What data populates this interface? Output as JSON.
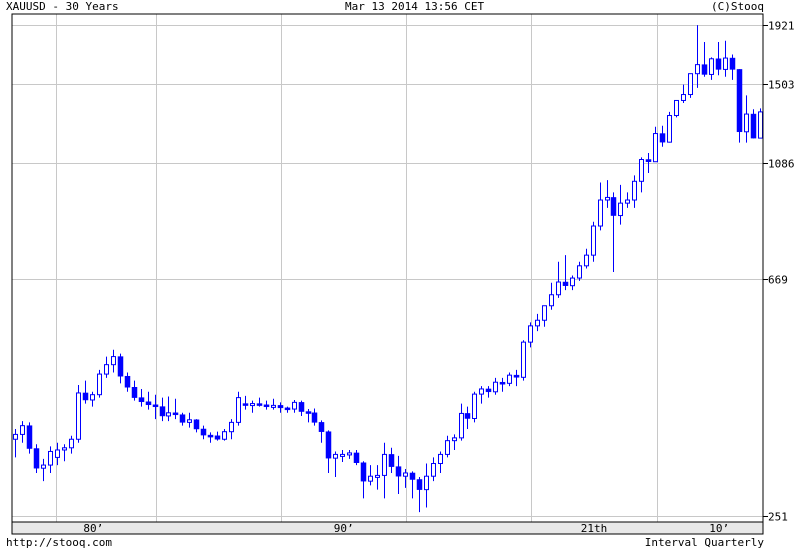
{
  "header": {
    "left": "XAUUSD - 30 Years",
    "center": "Mar 13 2014 13:56 CET",
    "right": "(C)Stooq"
  },
  "footer": {
    "left": "http://stooq.com",
    "right": "Interval Quarterly"
  },
  "colors": {
    "candle": "#0000ff",
    "grid": "#c8c8c8",
    "frame": "#000000",
    "xaxis_band": "#e8e8e8"
  },
  "chart_data": {
    "type": "candlestick",
    "title": "XAUUSD - 30 Years",
    "interval": "Quarterly",
    "y_scale": "log",
    "ylim": [
      251,
      1921
    ],
    "y_ticks": [
      251,
      669,
      1086,
      1503,
      1921
    ],
    "x_start": 1984.25,
    "x_end": 2014.25,
    "x_ticks": [
      {
        "label": "80’",
        "year": 1987.5
      },
      {
        "label": "90’",
        "year": 1997.5
      },
      {
        "label": "21th",
        "year": 2007.5
      },
      {
        "label": "10’",
        "year": 2012.5
      }
    ],
    "x_gridlines": [
      1986.0,
      1990.0,
      1995.0,
      2000.0,
      2005.0,
      2010.0
    ],
    "ohlc": [
      [
        345,
        360,
        320,
        352
      ],
      [
        352,
        372,
        340,
        365
      ],
      [
        365,
        370,
        325,
        332
      ],
      [
        332,
        338,
        300,
        306
      ],
      [
        306,
        318,
        290,
        310
      ],
      [
        310,
        335,
        300,
        328
      ],
      [
        320,
        340,
        310,
        330
      ],
      [
        330,
        338,
        315,
        333
      ],
      [
        333,
        350,
        325,
        345
      ],
      [
        345,
        432,
        340,
        418
      ],
      [
        418,
        440,
        400,
        406
      ],
      [
        406,
        420,
        395,
        415
      ],
      [
        415,
        460,
        410,
        452
      ],
      [
        452,
        486,
        445,
        470
      ],
      [
        470,
        500,
        455,
        486
      ],
      [
        486,
        492,
        435,
        448
      ],
      [
        448,
        455,
        420,
        428
      ],
      [
        428,
        440,
        405,
        410
      ],
      [
        410,
        425,
        395,
        403
      ],
      [
        403,
        420,
        390,
        398
      ],
      [
        398,
        415,
        375,
        395
      ],
      [
        395,
        410,
        372,
        380
      ],
      [
        380,
        412,
        372,
        385
      ],
      [
        385,
        408,
        375,
        382
      ],
      [
        382,
        385,
        365,
        370
      ],
      [
        370,
        385,
        362,
        374
      ],
      [
        374,
        375,
        355,
        360
      ],
      [
        360,
        365,
        345,
        351
      ],
      [
        351,
        355,
        340,
        350
      ],
      [
        350,
        356,
        343,
        345
      ],
      [
        345,
        360,
        343,
        356
      ],
      [
        356,
        375,
        345,
        370
      ],
      [
        370,
        420,
        365,
        410
      ],
      [
        400,
        413,
        390,
        398
      ],
      [
        398,
        405,
        385,
        400
      ],
      [
        400,
        410,
        395,
        398
      ],
      [
        398,
        405,
        390,
        395
      ],
      [
        395,
        408,
        390,
        397
      ],
      [
        397,
        402,
        385,
        393
      ],
      [
        393,
        395,
        385,
        391
      ],
      [
        391,
        406,
        385,
        402
      ],
      [
        402,
        405,
        380,
        387
      ],
      [
        387,
        391,
        370,
        385
      ],
      [
        385,
        392,
        365,
        370
      ],
      [
        370,
        373,
        340,
        356
      ],
      [
        356,
        358,
        300,
        319
      ],
      [
        319,
        328,
        295,
        324
      ],
      [
        324,
        330,
        314,
        324
      ],
      [
        324,
        330,
        318,
        326
      ],
      [
        326,
        330,
        310,
        313
      ],
      [
        313,
        315,
        270,
        290
      ],
      [
        290,
        310,
        285,
        296
      ],
      [
        296,
        310,
        280,
        297
      ],
      [
        297,
        340,
        270,
        324
      ],
      [
        324,
        333,
        300,
        308
      ],
      [
        308,
        322,
        275,
        296
      ],
      [
        296,
        305,
        282,
        300
      ],
      [
        300,
        302,
        270,
        292
      ],
      [
        292,
        295,
        255,
        280
      ],
      [
        280,
        312,
        260,
        296
      ],
      [
        296,
        320,
        290,
        312
      ],
      [
        312,
        328,
        300,
        324
      ],
      [
        324,
        350,
        320,
        343
      ],
      [
        343,
        352,
        330,
        347
      ],
      [
        347,
        400,
        343,
        384
      ],
      [
        384,
        395,
        360,
        376
      ],
      [
        376,
        420,
        370,
        416
      ],
      [
        416,
        430,
        400,
        425
      ],
      [
        425,
        430,
        410,
        420
      ],
      [
        420,
        445,
        415,
        437
      ],
      [
        437,
        445,
        420,
        435
      ],
      [
        435,
        455,
        430,
        450
      ],
      [
        450,
        460,
        430,
        446
      ],
      [
        446,
        520,
        440,
        516
      ],
      [
        516,
        560,
        505,
        552
      ],
      [
        552,
        580,
        540,
        565
      ],
      [
        565,
        600,
        550,
        600
      ],
      [
        600,
        660,
        590,
        628
      ],
      [
        628,
        720,
        620,
        662
      ],
      [
        662,
        740,
        640,
        652
      ],
      [
        652,
        680,
        640,
        673
      ],
      [
        673,
        720,
        665,
        708
      ],
      [
        708,
        760,
        700,
        740
      ],
      [
        740,
        850,
        720,
        835
      ],
      [
        835,
        1000,
        820,
        930
      ],
      [
        930,
        1010,
        900,
        940
      ],
      [
        940,
        960,
        690,
        872
      ],
      [
        872,
        990,
        840,
        918
      ],
      [
        918,
        960,
        900,
        930
      ],
      [
        930,
        1030,
        900,
        1005
      ],
      [
        1005,
        1110,
        960,
        1100
      ],
      [
        1100,
        1130,
        1040,
        1090
      ],
      [
        1090,
        1260,
        1090,
        1225
      ],
      [
        1225,
        1265,
        1160,
        1182
      ],
      [
        1182,
        1340,
        1180,
        1320
      ],
      [
        1320,
        1400,
        1310,
        1405
      ],
      [
        1405,
        1500,
        1390,
        1440
      ],
      [
        1440,
        1570,
        1420,
        1570
      ],
      [
        1570,
        1920,
        1480,
        1630
      ],
      [
        1630,
        1790,
        1550,
        1565
      ],
      [
        1565,
        1680,
        1530,
        1670
      ],
      [
        1670,
        1790,
        1560,
        1598
      ],
      [
        1598,
        1800,
        1550,
        1675
      ],
      [
        1675,
        1700,
        1530,
        1598
      ],
      [
        1598,
        1600,
        1180,
        1234
      ],
      [
        1234,
        1435,
        1180,
        1328
      ],
      [
        1328,
        1355,
        1200,
        1202
      ],
      [
        1202,
        1360,
        1200,
        1340
      ]
    ]
  }
}
